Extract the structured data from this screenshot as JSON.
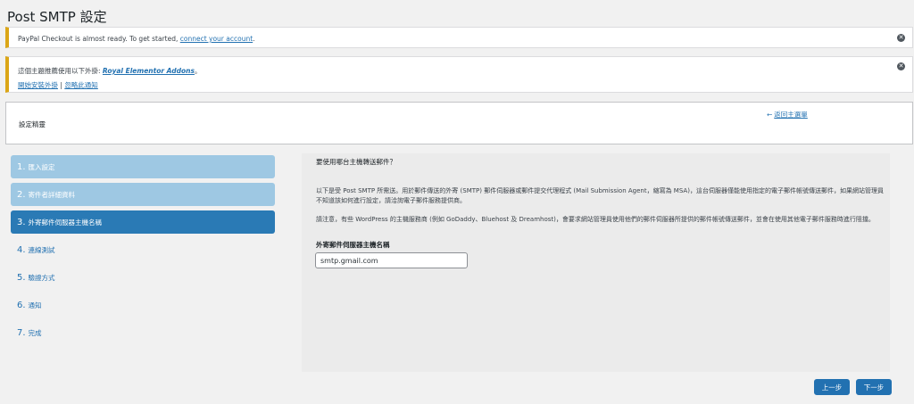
{
  "page": {
    "title": "Post SMTP 設定"
  },
  "notice_paypal": {
    "text": "PayPal Checkout is almost ready. To get started, ",
    "link": "connect your account",
    "suffix": "."
  },
  "notice_theme": {
    "text": "這個主題推薦使用以下外掛: ",
    "plugin": "Royal Elementor Addons",
    "suffix": "。",
    "install_link": "開始安裝外掛",
    "separator": "|",
    "dismiss_link": "忽略此通知"
  },
  "wizard": {
    "title": "設定精靈",
    "back_arrow": "←",
    "back_link": "返回主選單"
  },
  "steps": [
    {
      "num": "1.",
      "label": "匯入設定",
      "state": "done"
    },
    {
      "num": "2.",
      "label": "寄件者詳細資料",
      "state": "done"
    },
    {
      "num": "3.",
      "label": "外寄郵件伺服器主機名稱",
      "state": "active"
    },
    {
      "num": "4.",
      "label": "連線測試",
      "state": "todo"
    },
    {
      "num": "5.",
      "label": "驗證方式",
      "state": "todo"
    },
    {
      "num": "6.",
      "label": "通知",
      "state": "todo"
    },
    {
      "num": "7.",
      "label": "完成",
      "state": "todo"
    }
  ],
  "content": {
    "question": "要使用哪台主機轉送郵件？",
    "para1": "以下是受 Post SMTP 所需送。用於郵件傳送的外寄 (SMTP) 郵件伺服器或郵件提交代理程式 (Mail Submission Agent，縮寫為 MSA)，這台伺服器僅能使用指定的電子郵件帳號傳送郵件，如果網站管理員不知道該如何進行設定，請洽詢電子郵件服務提供商。",
    "para2": "請注意，有些 WordPress 的主機服務商 (例如 GoDaddy、Bluehost 及 Dreamhost)，會要求網站管理員使用他們的郵件伺服器所提供的郵件帳號傳送郵件，並會在使用其他電子郵件服務時進行阻擋。",
    "field_label": "外寄郵件伺服器主機名稱",
    "field_value": "smtp.gmail.com"
  },
  "buttons": {
    "prev": "上一步",
    "next": "下一步"
  },
  "icons": {
    "dismiss": "close-circle-icon"
  },
  "colors": {
    "accent": "#2271b1",
    "step_done": "#9ec8e3",
    "step_active": "#2a7ab5",
    "notice_border": "#dba617"
  }
}
